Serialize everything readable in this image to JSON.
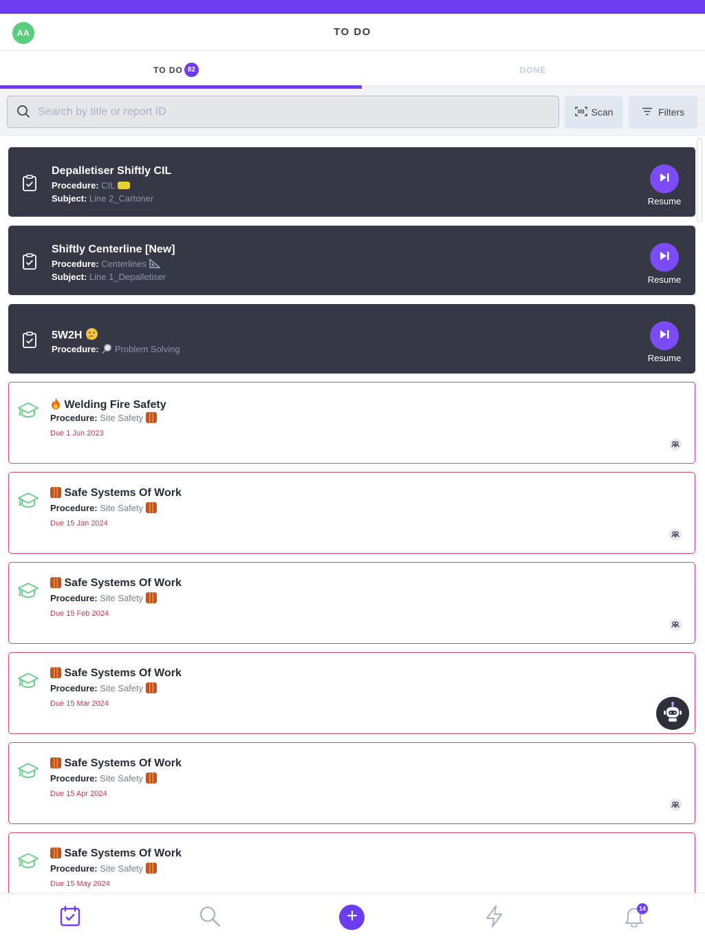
{
  "header": {
    "avatar_initials": "AA",
    "title": "TO DO"
  },
  "tabs": {
    "todo_label": "TO DO",
    "todo_count": "82",
    "done_label": "DONE"
  },
  "search": {
    "placeholder": "Search by title or report ID",
    "value": "",
    "scan_label": "Scan",
    "filters_label": "Filters"
  },
  "labels": {
    "procedure": "Procedure:",
    "subject": "Subject:",
    "resume": "Resume"
  },
  "in_progress": [
    {
      "title": "Depalletiser Shiftly CIL",
      "procedure": "CIL",
      "procedure_icon": "sponge-emoji",
      "subject": "Line 2_Cartoner"
    },
    {
      "title": "Shiftly Centerline [New]",
      "procedure": "Centerlines",
      "procedure_icon": "triangular-ruler-emoji",
      "subject": "Line 1_Depalletiser"
    },
    {
      "title": "5W2H",
      "title_icon": "thinking-face-emoji",
      "procedure": "Problem Solving",
      "procedure_icon": "magnifying-glass-emoji"
    }
  ],
  "trainings": [
    {
      "title": "Welding Fire Safety",
      "title_icon": "fire-emoji",
      "procedure": "Site Safety",
      "due": "Due 1 Jun 2023"
    },
    {
      "title": "Safe Systems Of Work",
      "title_icon": "safety-vest-emoji",
      "procedure": "Site Safety",
      "due": "Due 15 Jan 2024"
    },
    {
      "title": "Safe Systems Of Work",
      "title_icon": "safety-vest-emoji",
      "procedure": "Site Safety",
      "due": "Due 15 Feb 2024"
    },
    {
      "title": "Safe Systems Of Work",
      "title_icon": "safety-vest-emoji",
      "procedure": "Site Safety",
      "due": "Due 15 Mar 2024"
    },
    {
      "title": "Safe Systems Of Work",
      "title_icon": "safety-vest-emoji",
      "procedure": "Site Safety",
      "due": "Due 15 Apr 2024"
    },
    {
      "title": "Safe Systems Of Work",
      "title_icon": "safety-vest-emoji",
      "procedure": "Site Safety",
      "due": "Due 15 May 2024"
    }
  ],
  "bottom_nav": {
    "items": [
      "calendar-check-icon",
      "search-icon",
      "plus-icon",
      "lightning-icon",
      "bell-icon"
    ],
    "notification_count": "14"
  },
  "colors": {
    "accent": "#6c3cf0",
    "dark_card": "#363846",
    "due_red": "#d6334f",
    "training_green": "#5ccc7e"
  }
}
